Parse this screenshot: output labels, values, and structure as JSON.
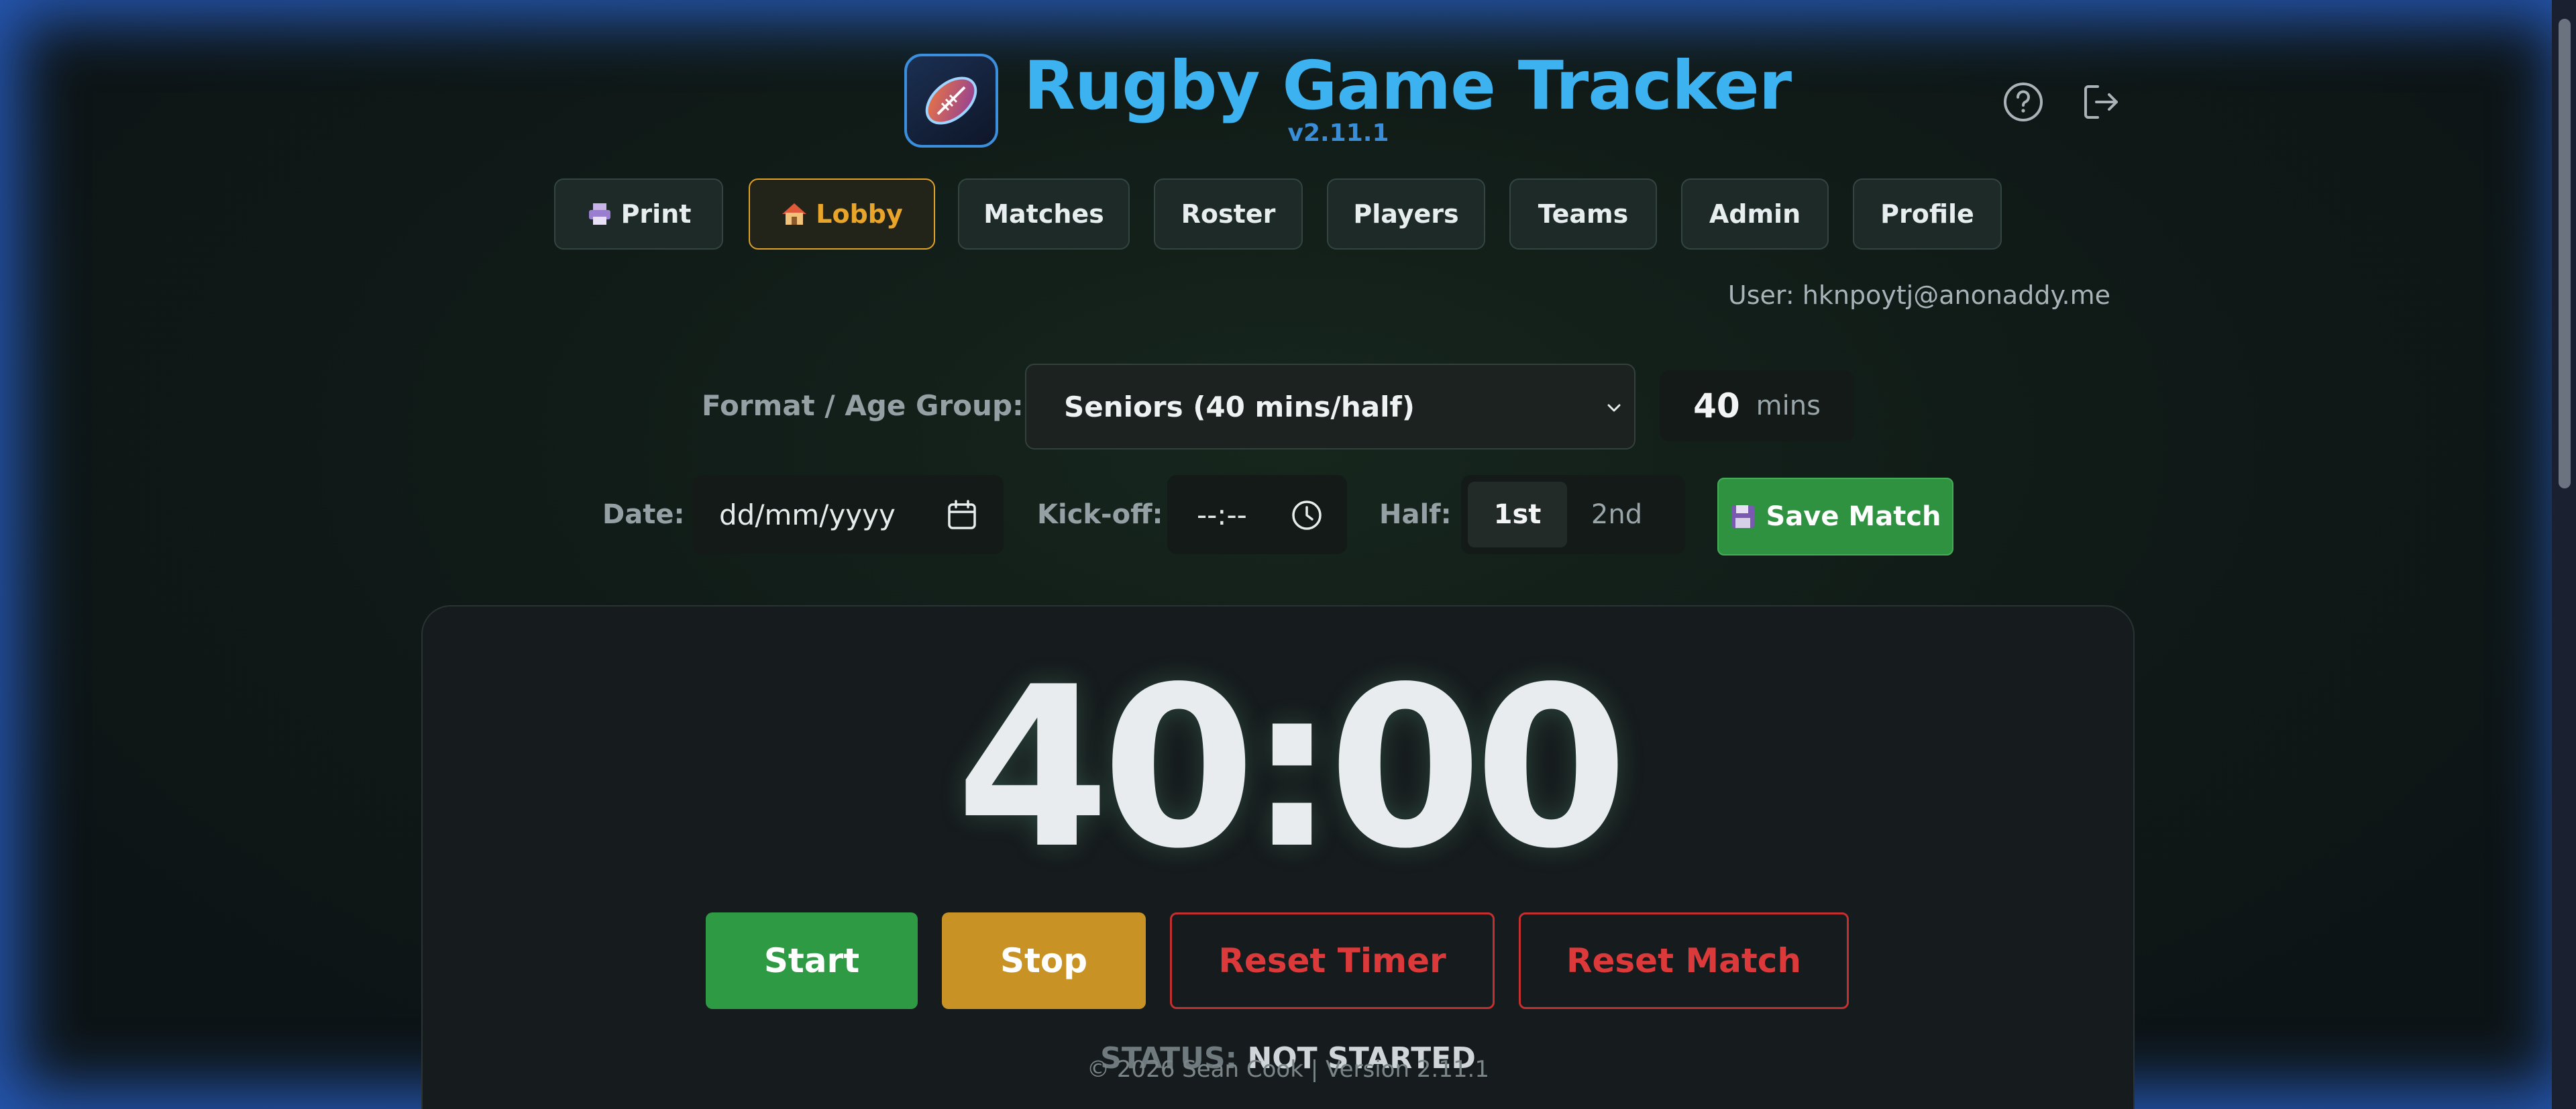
{
  "header": {
    "title": "Rugby Game Tracker",
    "version": "v2.11.1",
    "logo_icon": "rugby-ball-icon",
    "help_icon": "help-circle-icon",
    "logout_icon": "logout-icon"
  },
  "nav": {
    "items": [
      {
        "label": "Print",
        "icon": "printer-icon",
        "active": false
      },
      {
        "label": "Lobby",
        "icon": "house-icon",
        "active": true
      },
      {
        "label": "Matches",
        "active": false
      },
      {
        "label": "Roster",
        "active": false
      },
      {
        "label": "Players",
        "active": false
      },
      {
        "label": "Teams",
        "active": false
      },
      {
        "label": "Admin",
        "active": false
      },
      {
        "label": "Profile",
        "active": false
      }
    ]
  },
  "user": {
    "label": "User: hknpoytj@anonaddy.me"
  },
  "controls": {
    "format_label": "Format / Age Group:",
    "format_value": "Seniors (40 mins/half)",
    "mins_value": "40",
    "mins_unit": "mins",
    "date_label": "Date:",
    "date_placeholder": "dd/mm/yyyy",
    "kickoff_label": "Kick-off:",
    "kickoff_placeholder": "--:--",
    "half_label": "Half:",
    "half_options": [
      "1st",
      "2nd"
    ],
    "half_selected": "1st",
    "save_label": "Save Match"
  },
  "timer": {
    "display": "40:00",
    "start_label": "Start",
    "stop_label": "Stop",
    "reset_timer_label": "Reset Timer",
    "reset_match_label": "Reset Match",
    "status_label": "STATUS:",
    "status_value": "NOT STARTED"
  },
  "footer": {
    "text": "© 2026 Sean Cook | Version 2.11.1"
  },
  "colors": {
    "accent_blue": "#3cb2f0",
    "active_orange": "#e8a52a",
    "start_green": "#2e9a44",
    "stop_amber": "#c89324",
    "reset_red": "#dc3a3a"
  }
}
